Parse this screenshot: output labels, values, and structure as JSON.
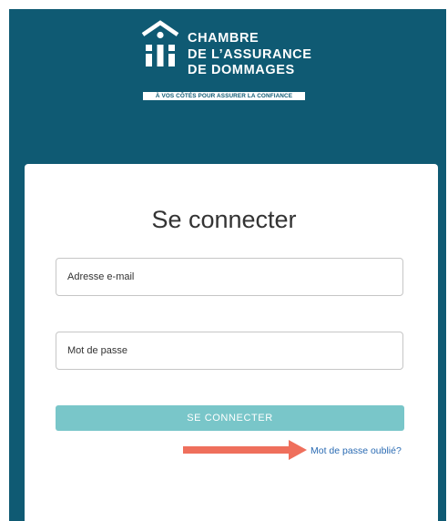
{
  "brand": {
    "name_lines": [
      "CHAMBRE",
      "DE L’ASSURANCE",
      "DE DOMMAGES"
    ],
    "tagline": "À VOS CÔTÉS POUR ASSURER LA CONFIANCE",
    "color": "#0f5a73"
  },
  "login": {
    "title": "Se connecter",
    "email_placeholder": "Adresse e-mail",
    "password_placeholder": "Mot de passe",
    "submit_label": "SE CONNECTER",
    "submit_color": "#79c6c9",
    "forgot_password_label": "Mot de passe oublié?",
    "link_color": "#2a6bb3"
  },
  "annotation": {
    "icon": "arrow-right-icon",
    "color": "#ef6f5c"
  }
}
